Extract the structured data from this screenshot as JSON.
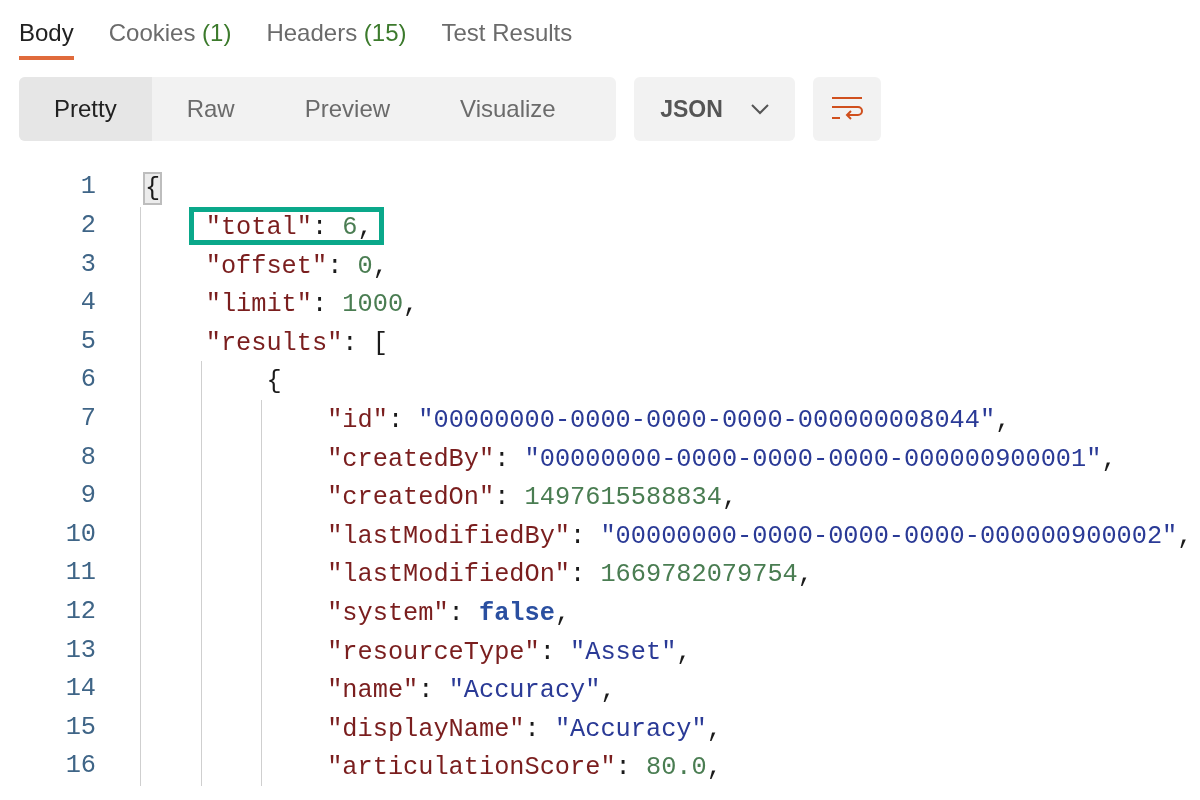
{
  "tabs": [
    {
      "label": "Body",
      "selected": true
    },
    {
      "label": "Cookies",
      "count": "(1)",
      "selected": false
    },
    {
      "label": "Headers",
      "count": "(15)",
      "selected": false
    },
    {
      "label": "Test Results",
      "selected": false
    }
  ],
  "view_modes": [
    {
      "label": "Pretty",
      "selected": true
    },
    {
      "label": "Raw",
      "selected": false
    },
    {
      "label": "Preview",
      "selected": false
    },
    {
      "label": "Visualize",
      "selected": false
    }
  ],
  "format_dropdown": {
    "value": "JSON"
  },
  "code_lines": [
    {
      "number": "1",
      "bracket_match": true,
      "highlighted": false,
      "tokens": [
        {
          "kind": "punct",
          "text": "{"
        }
      ],
      "children": [
        {
          "number": "2",
          "highlighted": true,
          "tokens": [
            {
              "kind": "key",
              "text": "\"total\""
            },
            {
              "kind": "punct",
              "text": ": "
            },
            {
              "kind": "number",
              "text": "6"
            },
            {
              "kind": "punct",
              "text": ","
            }
          ]
        },
        {
          "number": "3",
          "highlighted": false,
          "tokens": [
            {
              "kind": "key",
              "text": "\"offset\""
            },
            {
              "kind": "punct",
              "text": ": "
            },
            {
              "kind": "number",
              "text": "0"
            },
            {
              "kind": "punct",
              "text": ","
            }
          ]
        },
        {
          "number": "4",
          "highlighted": false,
          "tokens": [
            {
              "kind": "key",
              "text": "\"limit\""
            },
            {
              "kind": "punct",
              "text": ": "
            },
            {
              "kind": "number",
              "text": "1000"
            },
            {
              "kind": "punct",
              "text": ","
            }
          ]
        },
        {
          "number": "5",
          "highlighted": false,
          "tokens": [
            {
              "kind": "key",
              "text": "\"results\""
            },
            {
              "kind": "punct",
              "text": ": ["
            }
          ],
          "children": [
            {
              "number": "6",
              "highlighted": false,
              "tokens": [
                {
                  "kind": "punct",
                  "text": "{"
                }
              ],
              "children": [
                {
                  "number": "7",
                  "highlighted": false,
                  "tokens": [
                    {
                      "kind": "key",
                      "text": "\"id\""
                    },
                    {
                      "kind": "punct",
                      "text": ": "
                    },
                    {
                      "kind": "string",
                      "text": "\"00000000-0000-0000-0000-000000008044\""
                    },
                    {
                      "kind": "punct",
                      "text": ","
                    }
                  ]
                },
                {
                  "number": "8",
                  "highlighted": false,
                  "tokens": [
                    {
                      "kind": "key",
                      "text": "\"createdBy\""
                    },
                    {
                      "kind": "punct",
                      "text": ": "
                    },
                    {
                      "kind": "string",
                      "text": "\"00000000-0000-0000-0000-000000900001\""
                    },
                    {
                      "kind": "punct",
                      "text": ","
                    }
                  ]
                },
                {
                  "number": "9",
                  "highlighted": false,
                  "tokens": [
                    {
                      "kind": "key",
                      "text": "\"createdOn\""
                    },
                    {
                      "kind": "punct",
                      "text": ": "
                    },
                    {
                      "kind": "number",
                      "text": "1497615588834"
                    },
                    {
                      "kind": "punct",
                      "text": ","
                    }
                  ]
                },
                {
                  "number": "10",
                  "highlighted": false,
                  "tokens": [
                    {
                      "kind": "key",
                      "text": "\"lastModifiedBy\""
                    },
                    {
                      "kind": "punct",
                      "text": ": "
                    },
                    {
                      "kind": "string",
                      "text": "\"00000000-0000-0000-0000-000000900002\""
                    },
                    {
                      "kind": "punct",
                      "text": ","
                    }
                  ]
                },
                {
                  "number": "11",
                  "highlighted": false,
                  "tokens": [
                    {
                      "kind": "key",
                      "text": "\"lastModifiedOn\""
                    },
                    {
                      "kind": "punct",
                      "text": ": "
                    },
                    {
                      "kind": "number",
                      "text": "1669782079754"
                    },
                    {
                      "kind": "punct",
                      "text": ","
                    }
                  ]
                },
                {
                  "number": "12",
                  "highlighted": false,
                  "tokens": [
                    {
                      "kind": "key",
                      "text": "\"system\""
                    },
                    {
                      "kind": "punct",
                      "text": ": "
                    },
                    {
                      "kind": "bool",
                      "text": "false"
                    },
                    {
                      "kind": "punct",
                      "text": ","
                    }
                  ]
                },
                {
                  "number": "13",
                  "highlighted": false,
                  "tokens": [
                    {
                      "kind": "key",
                      "text": "\"resourceType\""
                    },
                    {
                      "kind": "punct",
                      "text": ": "
                    },
                    {
                      "kind": "string",
                      "text": "\"Asset\""
                    },
                    {
                      "kind": "punct",
                      "text": ","
                    }
                  ]
                },
                {
                  "number": "14",
                  "highlighted": false,
                  "tokens": [
                    {
                      "kind": "key",
                      "text": "\"name\""
                    },
                    {
                      "kind": "punct",
                      "text": ": "
                    },
                    {
                      "kind": "string",
                      "text": "\"Accuracy\""
                    },
                    {
                      "kind": "punct",
                      "text": ","
                    }
                  ]
                },
                {
                  "number": "15",
                  "highlighted": false,
                  "tokens": [
                    {
                      "kind": "key",
                      "text": "\"displayName\""
                    },
                    {
                      "kind": "punct",
                      "text": ": "
                    },
                    {
                      "kind": "string",
                      "text": "\"Accuracy\""
                    },
                    {
                      "kind": "punct",
                      "text": ","
                    }
                  ]
                },
                {
                  "number": "16",
                  "highlighted": false,
                  "tokens": [
                    {
                      "kind": "key",
                      "text": "\"articulationScore\""
                    },
                    {
                      "kind": "punct",
                      "text": ": "
                    },
                    {
                      "kind": "number",
                      "text": "80.0"
                    },
                    {
                      "kind": "punct",
                      "text": ","
                    }
                  ]
                }
              ]
            }
          ]
        }
      ]
    }
  ]
}
